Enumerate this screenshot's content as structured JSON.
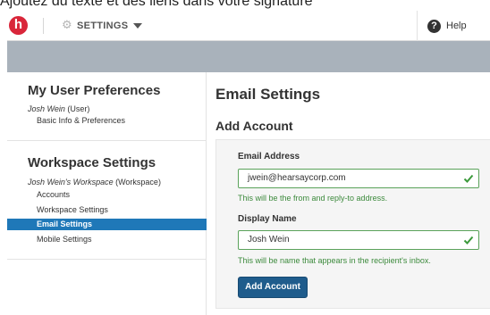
{
  "caption": "Ajoutez du texte et des liens dans votre signature",
  "topbar": {
    "logo_letter": "h",
    "settings_label": "SETTINGS",
    "help_label": "Help"
  },
  "sidebar": {
    "user_prefs": {
      "heading": "My User Preferences",
      "user_name": "Josh Wein",
      "user_role": " (User)",
      "items": [
        "Basic Info & Preferences"
      ]
    },
    "workspace": {
      "heading": "Workspace Settings",
      "workspace_name": "Josh Wein's Workspace",
      "workspace_suffix": " (Workspace)",
      "items": [
        {
          "label": "Accounts",
          "active": false
        },
        {
          "label": "Workspace Settings",
          "active": false
        },
        {
          "label": "Email Settings",
          "active": true
        },
        {
          "label": "Mobile Settings",
          "active": false
        }
      ]
    }
  },
  "main": {
    "title": "Email Settings",
    "subtitle": "Add Account",
    "form": {
      "email_label": "Email Address",
      "email_value": "jwein@hearsaycorp.com",
      "email_hint": "This will be the from and reply-to address.",
      "name_label": "Display Name",
      "name_value": "Josh Wein",
      "name_hint": "This will be name that appears in the recipient's inbox.",
      "submit_label": "Add Account"
    }
  },
  "colors": {
    "brand_red": "#d9263a",
    "nav_band": "#a9b2bb",
    "active_item": "#1f78b8",
    "valid_green": "#5aa25a",
    "button_blue": "#1f5c8c"
  }
}
